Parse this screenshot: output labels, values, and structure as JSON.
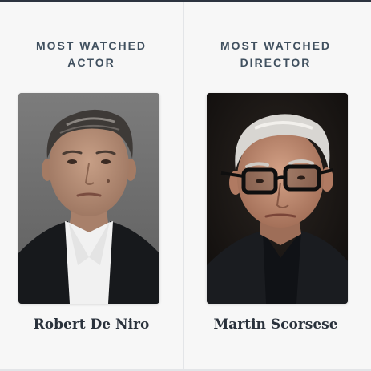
{
  "cards": [
    {
      "label_line1": "MOST WATCHED",
      "label_line2": "ACTOR",
      "name": "Robert De Niro",
      "photo_alt": "Robert De Niro"
    },
    {
      "label_line1": "MOST WATCHED",
      "label_line2": "DIRECTOR",
      "name": "Martin Scorsese",
      "photo_alt": "Martin Scorsese"
    }
  ],
  "colors": {
    "label": "#40505f",
    "name": "#2a323c",
    "background": "#f7f7f7",
    "accent_bar": "#2d3440"
  }
}
